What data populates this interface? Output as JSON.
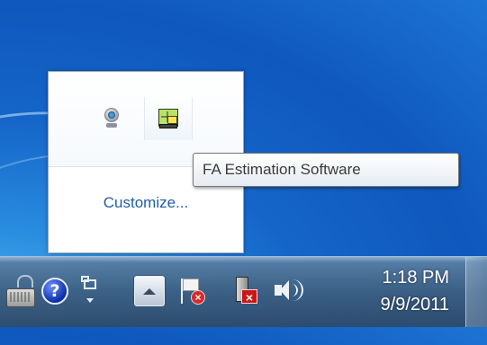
{
  "flyout": {
    "icons": [
      {
        "name": "webcam-icon"
      },
      {
        "name": "fa-estimation-software-icon"
      }
    ],
    "customize_link": "Customize..."
  },
  "tooltip": {
    "text": "FA Estimation Software"
  },
  "taskbar": {
    "tray_icons": [
      "on-screen-keyboard-icon",
      "help-icon",
      "language-bar-icon",
      "show-hidden-icons-button",
      "action-center-flag-icon",
      "network-disconnected-icon",
      "volume-icon"
    ],
    "clock": {
      "time": "1:18 PM",
      "date": "9/9/2011"
    }
  },
  "colors": {
    "link": "#1f5ea8",
    "tooltip_text": "#3b3b3b",
    "clock_text": "#ffffff"
  }
}
